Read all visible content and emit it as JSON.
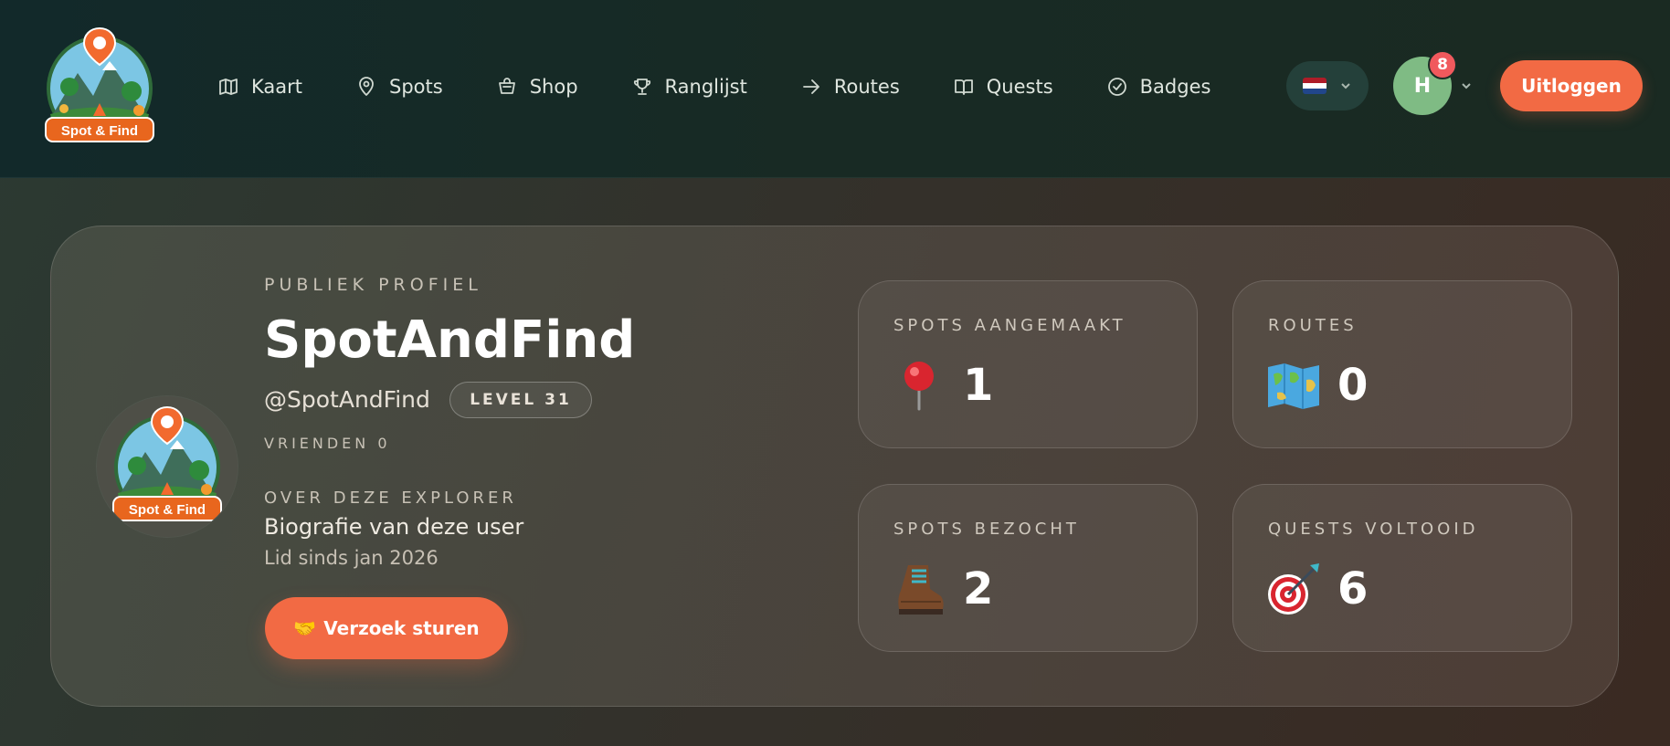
{
  "header": {
    "logo_text": "Spot & Find",
    "nav": [
      {
        "label": "Kaart",
        "icon": "map-icon"
      },
      {
        "label": "Spots",
        "icon": "map-pin-icon"
      },
      {
        "label": "Shop",
        "icon": "basket-icon"
      },
      {
        "label": "Ranglijst",
        "icon": "trophy-icon"
      },
      {
        "label": "Routes",
        "icon": "arrow-right-icon"
      },
      {
        "label": "Quests",
        "icon": "book-open-icon"
      },
      {
        "label": "Badges",
        "icon": "badge-check-icon"
      }
    ],
    "language": {
      "flag": "nl-flag-icon",
      "colors": [
        "#ae1c28",
        "#ffffff",
        "#21468b"
      ]
    },
    "user_avatar_initial": "H",
    "notification_count": "8",
    "logout_label": "Uitloggen"
  },
  "profile": {
    "eyebrow": "PUBLIEK PROFIEL",
    "name": "SpotAndFind",
    "handle": "@SpotAndFind",
    "level": "LEVEL 31",
    "friends": "VRIENDEN 0",
    "about_label": "OVER DEZE EXPLORER",
    "bio": "Biografie van deze user",
    "member_since": "Lid sinds jan 2026",
    "request_emoji": "🤝",
    "request_label": "Verzoek sturen"
  },
  "stats": [
    {
      "label": "SPOTS AANGEMAAKT",
      "icon": "pushpin-icon",
      "value": "1"
    },
    {
      "label": "ROUTES",
      "icon": "world-map-icon",
      "value": "0"
    },
    {
      "label": "SPOTS BEZOCHT",
      "icon": "hiking-boot-icon",
      "value": "2"
    },
    {
      "label": "QUESTS VOLTOOID",
      "icon": "target-icon",
      "value": "6"
    }
  ],
  "colors": {
    "accent": "#f26a44",
    "avatar_green": "#7fbb84",
    "badge_red": "#f0595d"
  }
}
